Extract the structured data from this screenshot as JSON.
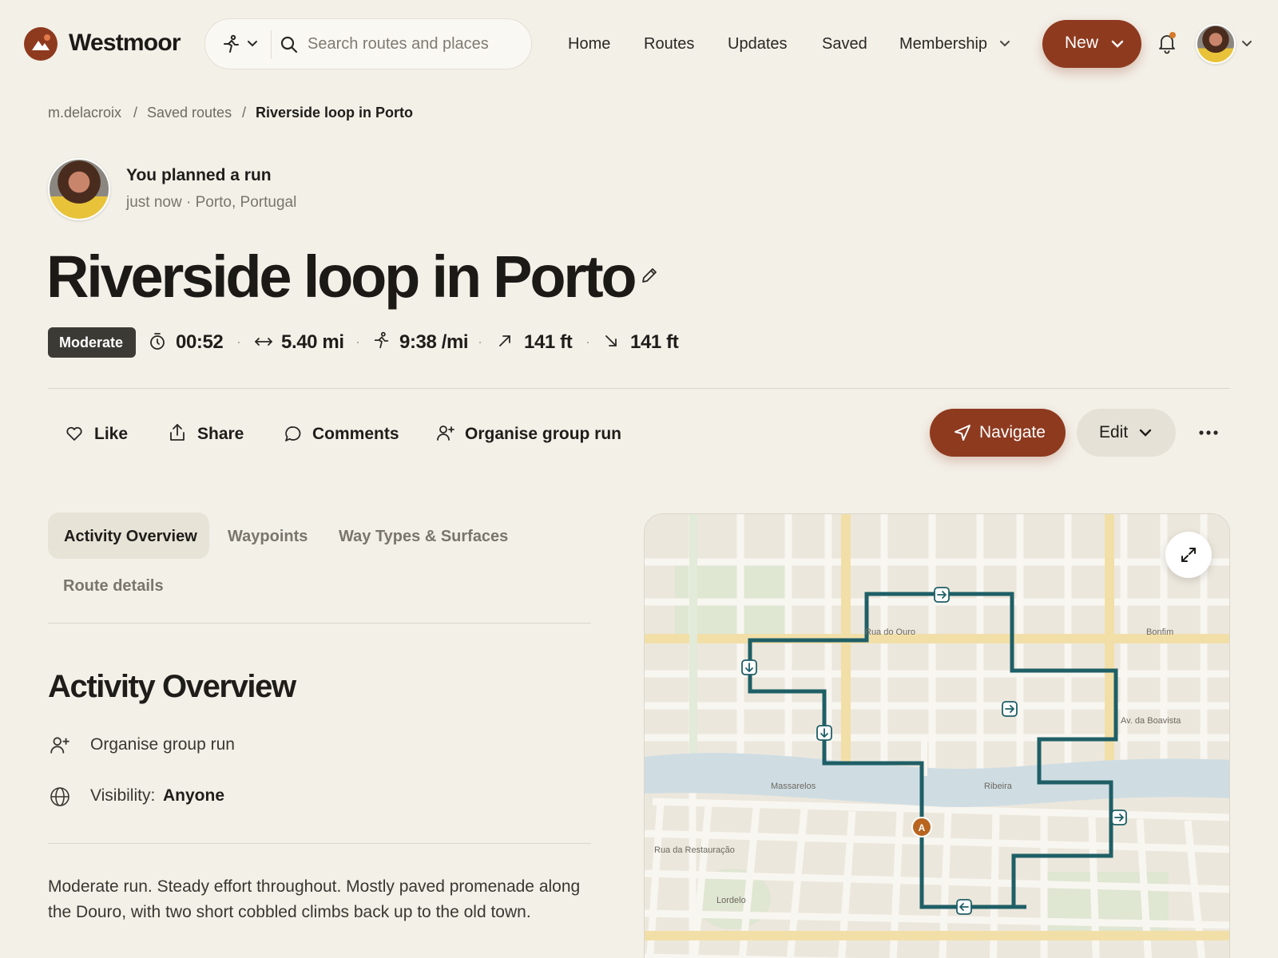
{
  "header": {
    "brand": "Westmoor",
    "search_placeholder": "Search routes and places",
    "nav": [
      "Home",
      "Routes",
      "Updates",
      "Saved",
      "Membership"
    ],
    "new_label": "New"
  },
  "breadcrumb": [
    "m.delacroix",
    "Saved routes",
    "Riverside loop in Porto"
  ],
  "owner": {
    "headline": "You planned a run",
    "meta": "just now · Porto, Portugal"
  },
  "route": {
    "title": "Riverside loop in Porto",
    "difficulty": "Moderate",
    "stats": {
      "duration": "00:52",
      "distance": "5.40 mi",
      "pace": "9:38 /mi",
      "ascent": "141 ft",
      "descent": "141 ft"
    }
  },
  "actions": {
    "like": "Like",
    "share": "Share",
    "comments": "Comments",
    "group": "Organise group run",
    "navigate": "Navigate",
    "edit": "Edit"
  },
  "tabs": [
    "Activity Overview",
    "Waypoints",
    "Way Types & Surfaces",
    "Route details"
  ],
  "overview": {
    "heading": "Activity Overview",
    "group_label": "Organise group run",
    "visibility_label": "Visibility:",
    "visibility_value": "Anyone",
    "description": "Moderate run. Steady effort throughout. Mostly paved promenade along the Douro, with two short cobbled climbs back up to the old town."
  },
  "map": {
    "labels": [
      "Rua do Ouro",
      "Bonfim",
      "Av. da Boavista",
      "Massarelos",
      "Ribeira",
      "Rua da Restauração",
      "Lordelo"
    ],
    "start_marker": "A",
    "route_color": "#1f5f66",
    "accent": "#8e3a1f"
  }
}
